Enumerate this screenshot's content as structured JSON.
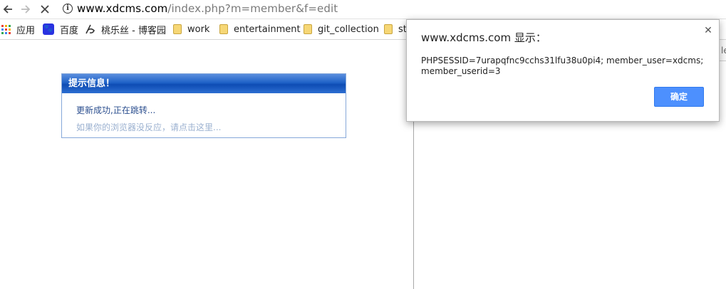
{
  "browser": {
    "url_host": "www.xdcms.com",
    "url_path": "/index.php?m=member&f=edit"
  },
  "bookmarks": [
    {
      "label": "应用",
      "icon": "apps-icon"
    },
    {
      "label": "百度",
      "icon": "baidu-icon"
    },
    {
      "label": "桃乐丝 - 博客园",
      "icon": "cnblogs-icon"
    },
    {
      "label": "work",
      "icon": "folder-icon"
    },
    {
      "label": "entertainment",
      "icon": "folder-icon"
    },
    {
      "label": "git_collection",
      "icon": "folder-icon"
    },
    {
      "label": "st",
      "icon": "folder-icon"
    }
  ],
  "notice_box": {
    "header": "提示信息！",
    "message": "更新成功,正在跳转...",
    "hint": "如果你的浏览器没反应，请点击这里..."
  },
  "alert_dialog": {
    "title": "www.xdcms.com 显示：",
    "message": "PHPSESSID=7urapqfnc9cchs31lfu38u0pi4; member_user=xdcms; member_userid=3",
    "ok_label": "确定"
  },
  "side_panel": {
    "peek_text": "le"
  },
  "colors": {
    "notice_header": "#1f62c7",
    "dialog_button": "#4d90fe",
    "folder": "#f6d776"
  }
}
